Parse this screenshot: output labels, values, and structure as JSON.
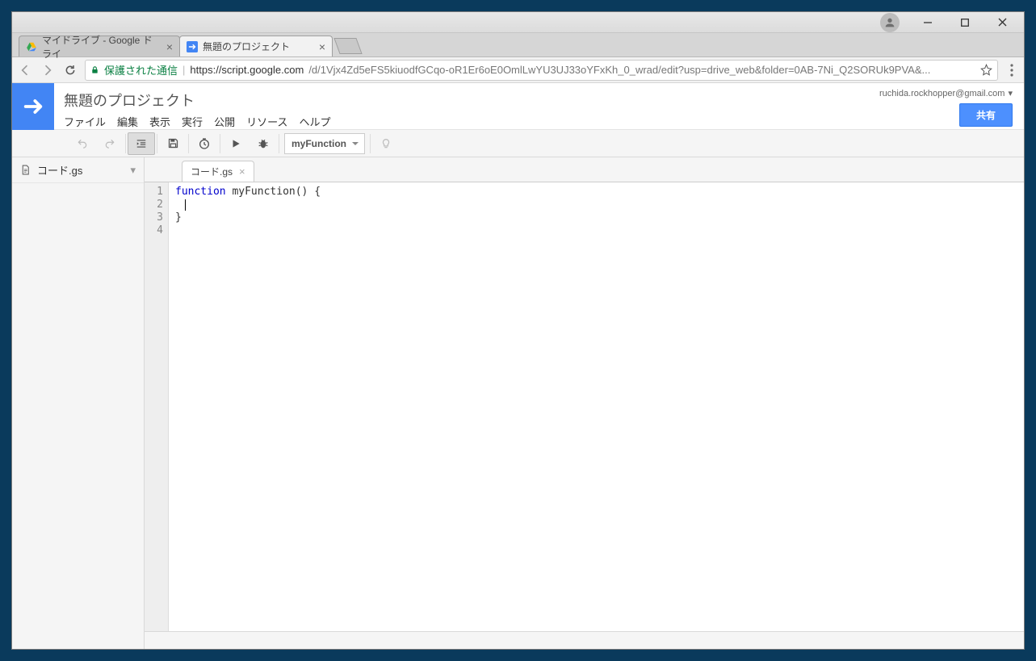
{
  "window": {
    "tabs": [
      {
        "title": "マイドライブ - Google ドライ",
        "active": false
      },
      {
        "title": "無題のプロジェクト",
        "active": true
      }
    ]
  },
  "addressbar": {
    "secure_label": "保護された通信",
    "url_domain": "https://script.google.com",
    "url_path": "/d/1Vjx4Zd5eFS5kiuodfGCqo-oR1Er6oE0OmlLwYU3UJ33oYFxKh_0_wrad/edit?usp=drive_web&folder=0AB-7Ni_Q2SORUk9PVA&..."
  },
  "header": {
    "project_title": "無題のプロジェクト",
    "menus": [
      "ファイル",
      "編集",
      "表示",
      "実行",
      "公開",
      "リソース",
      "ヘルプ"
    ],
    "user_email": "ruchida.rockhopper@gmail.com",
    "share_label": "共有"
  },
  "toolbar": {
    "function_selected": "myFunction"
  },
  "sidebar": {
    "file_name": "コード.gs"
  },
  "editor": {
    "tab_name": "コード.gs",
    "lines": {
      "l1_kw": "function",
      "l1_rest": " myFunction() {",
      "l3": "}",
      "numbers": [
        "1",
        "2",
        "3",
        "4"
      ]
    }
  }
}
